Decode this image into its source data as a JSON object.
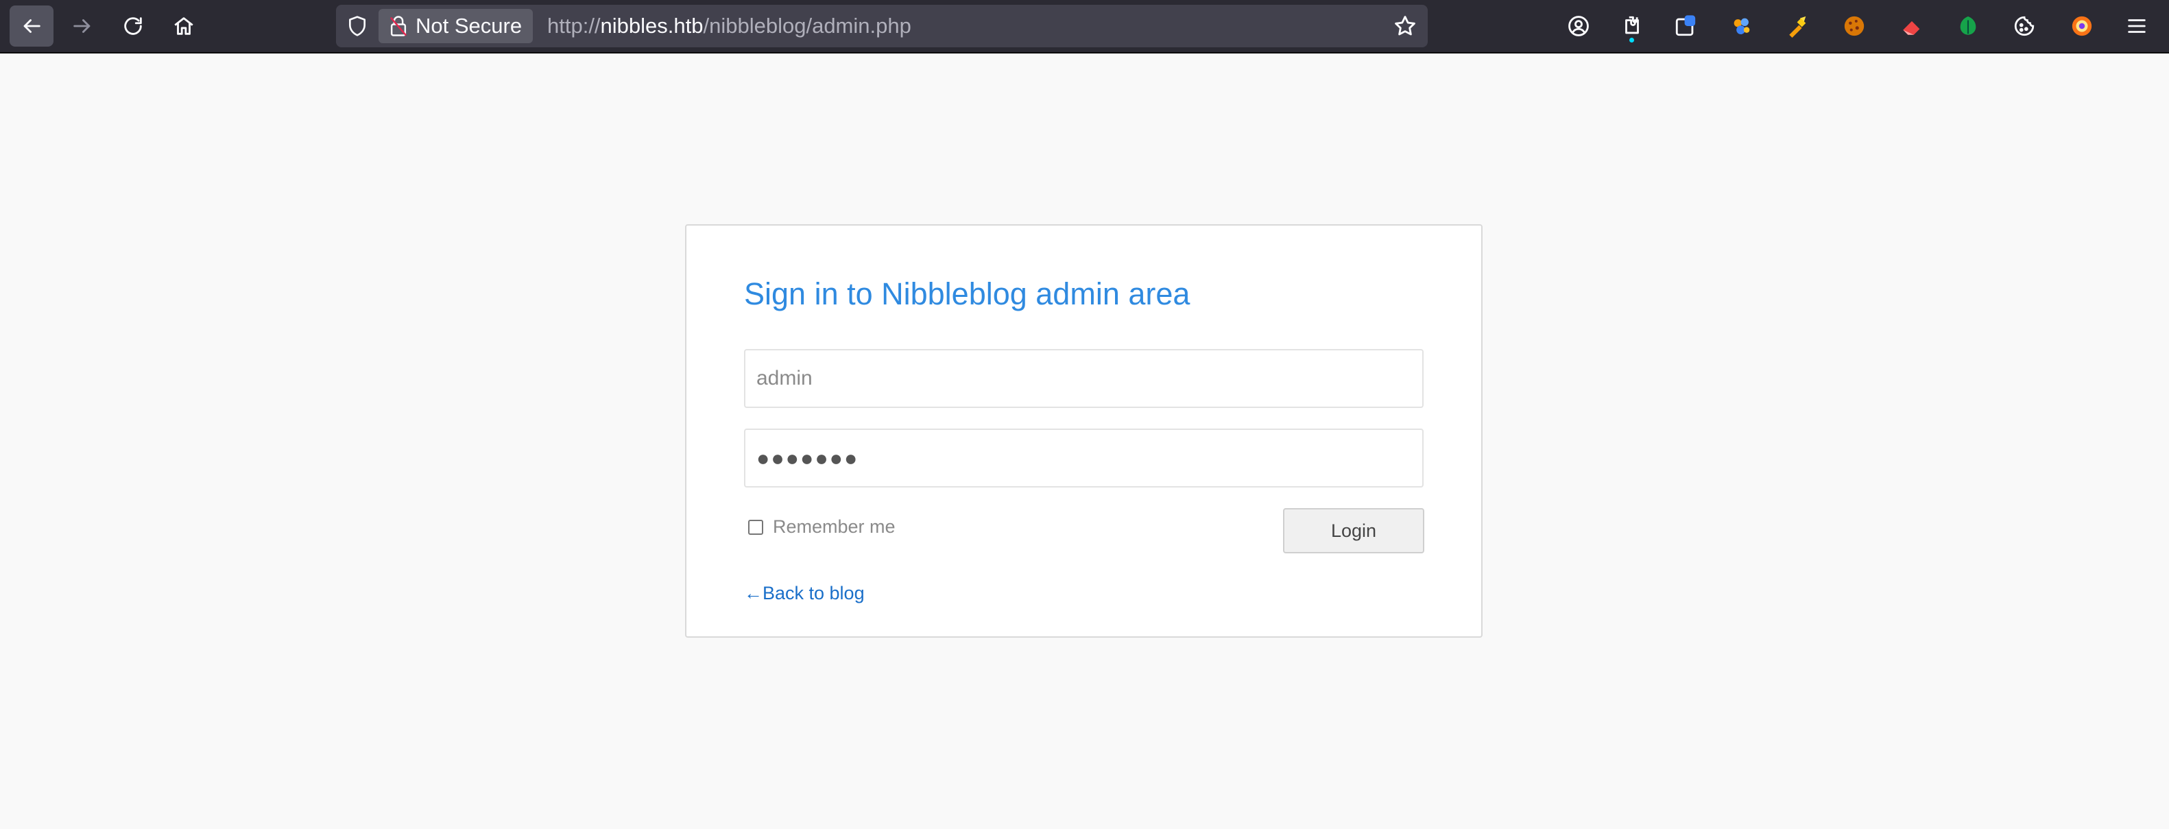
{
  "browser": {
    "nav": {
      "back_icon": "arrow-left-icon",
      "forward_icon": "arrow-right-icon",
      "reload_icon": "reload-icon",
      "home_icon": "home-icon"
    },
    "urlbar": {
      "security_label": "Not Secure",
      "url_scheme": "http://",
      "url_host": "nibbles.htb",
      "url_path": "/nibbleblog/admin.php"
    },
    "extensions": [
      "account-icon",
      "extensions-icon",
      "container-tabs-icon",
      "extension-puzzle-icon",
      "extension-wand-icon",
      "cookie-icon",
      "eraser-icon",
      "green-leaf-icon",
      "cookie-outline-icon",
      "firefox-extension-icon",
      "hamburger-menu-icon"
    ],
    "colors": {
      "toolbar_bg": "#2b2a33",
      "urlbar_bg": "#42414d",
      "page_bg": "#f9f9f9"
    }
  },
  "login": {
    "title": "Sign in to Nibbleblog admin area",
    "username_placeholder": "admin",
    "username_value": "",
    "password_mask": "●●●●●●●",
    "remember_label": "Remember me",
    "remember_checked": false,
    "login_button": "Login",
    "back_link": "←Back to blog",
    "colors": {
      "title": "#2f8ae0",
      "link": "#1a6fc9"
    }
  }
}
